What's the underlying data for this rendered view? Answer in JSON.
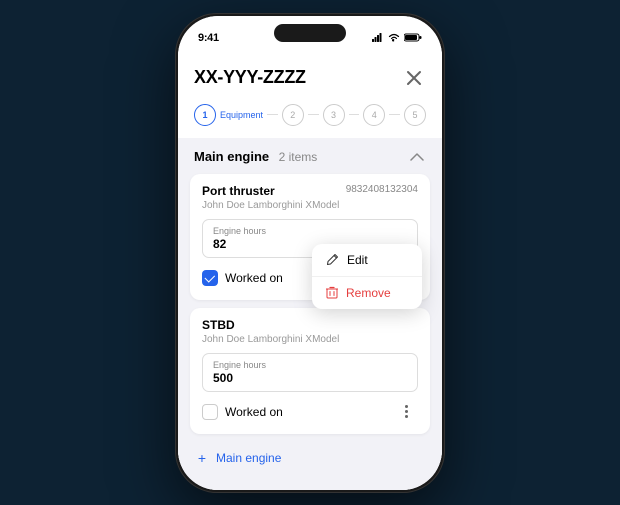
{
  "status_bar": {
    "time": "9:41",
    "signal_icon": "signal",
    "wifi_icon": "wifi",
    "battery_icon": "battery"
  },
  "modal": {
    "title": "XX-YYY-ZZZZ",
    "close_label": "×"
  },
  "steps": [
    {
      "number": "1",
      "label": "Equipment",
      "active": true
    },
    {
      "number": "2",
      "label": "",
      "active": false
    },
    {
      "number": "3",
      "label": "",
      "active": false
    },
    {
      "number": "4",
      "label": "",
      "active": false
    },
    {
      "number": "5",
      "label": "",
      "active": false
    }
  ],
  "section": {
    "title": "Main engine",
    "count": "2 items"
  },
  "equipment_items": [
    {
      "name": "Port thruster",
      "serial": "9832408132304",
      "sub": "John Doe Lamborghini XModel",
      "engine_hours_label": "Engine hours",
      "engine_hours_value": "82",
      "worked_on_label": "Worked on",
      "checked": true,
      "show_context_menu": true
    },
    {
      "name": "STBD",
      "serial": "",
      "sub": "John Doe Lamborghini XModel",
      "engine_hours_label": "Engine hours",
      "engine_hours_value": "500",
      "worked_on_label": "Worked on",
      "checked": false,
      "show_context_menu": false
    }
  ],
  "context_menu": {
    "edit_label": "Edit",
    "remove_label": "Remove"
  },
  "add_button": {
    "label": "Main engine",
    "icon": "+"
  }
}
